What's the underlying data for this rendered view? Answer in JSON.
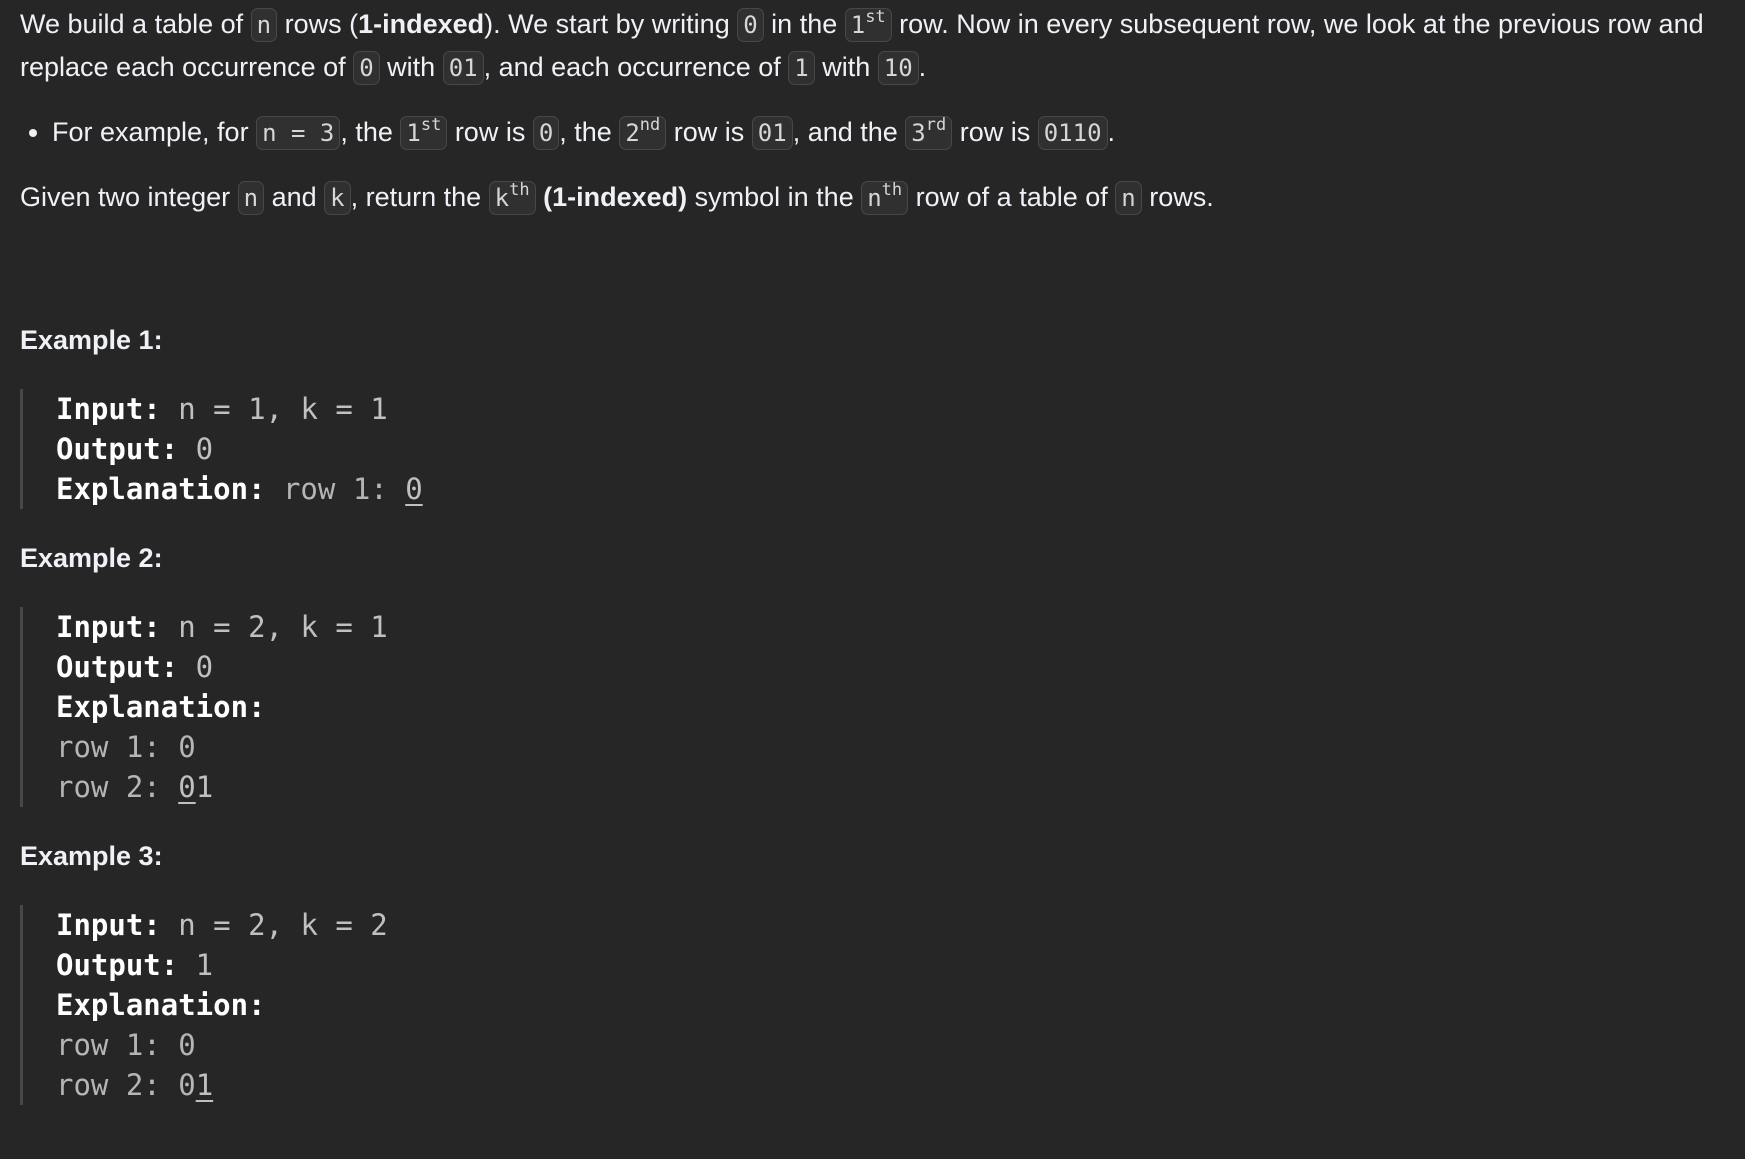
{
  "intro": {
    "t1": "We build a table of ",
    "n": "n",
    "t2": " rows (",
    "bold1": "1-indexed",
    "t3": "). We start by writing ",
    "zero": "0",
    "t4": " in the ",
    "first_num": "1",
    "first_sup": "st",
    "t5": " row. Now in every subsequent row, we look at the previous row and replace each occurrence of ",
    "zero2": "0",
    "t6": " with ",
    "code01": "01",
    "t7": ", and each occurrence of ",
    "one": "1",
    "t8": " with ",
    "code10": "10",
    "t9": "."
  },
  "bullet": {
    "t1": "For example, for ",
    "n3": "n = 3",
    "t2": ", the ",
    "r1_num": "1",
    "r1_sup": "st",
    "t3": " row is ",
    "r1_val": "0",
    "t4": ", the ",
    "r2_num": "2",
    "r2_sup": "nd",
    "t5": " row is ",
    "r2_val": "01",
    "t6": ", and the ",
    "r3_num": "3",
    "r3_sup": "rd",
    "t7": " row is ",
    "r3_val": "0110",
    "t8": "."
  },
  "question": {
    "t1": "Given two integer ",
    "n": "n",
    "t2": " and ",
    "k": "k",
    "t3": ", return the ",
    "k2": "k",
    "k_sup": "th",
    "t4": " ",
    "bold": "(1-indexed)",
    "t5": " symbol in the ",
    "n2": "n",
    "n_sup": "th",
    "t6": " row of a table of ",
    "n3": "n",
    "t7": " rows."
  },
  "labels": {
    "input": "Input:",
    "output": "Output:",
    "explanation": "Explanation:"
  },
  "examples": [
    {
      "title": "Example 1:",
      "input": " n = 1, k = 1",
      "output": " 0",
      "exp_prefix": " row 1: ",
      "exp_underlined": "0"
    },
    {
      "title": "Example 2:",
      "input": " n = 2, k = 1",
      "output": " 0",
      "row1": "row 1: 0",
      "row2_prefix": "row 2: ",
      "row2_underlined": "0",
      "row2_rest": "1"
    },
    {
      "title": "Example 3:",
      "input": " n = 2, k = 2",
      "output": " 1",
      "row1": "row 1: 0",
      "row2_prefix": "row 2: 0",
      "row2_underlined": "1"
    }
  ]
}
